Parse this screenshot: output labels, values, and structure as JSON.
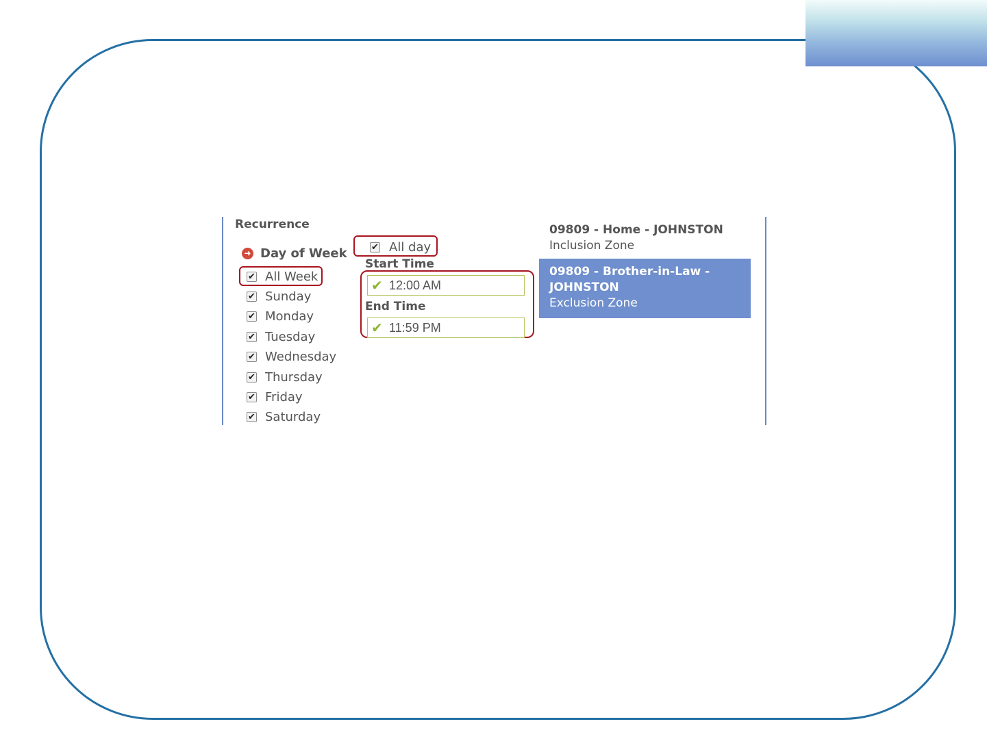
{
  "recurrence": {
    "title": "Recurrence",
    "day_of_week": {
      "title": "Day of Week",
      "icon": "arrow-right-circle-icon",
      "all_week": {
        "label": "All Week",
        "checked": true
      },
      "days": [
        {
          "label": "Sunday",
          "checked": true
        },
        {
          "label": "Monday",
          "checked": true
        },
        {
          "label": "Tuesday",
          "checked": true
        },
        {
          "label": "Wednesday",
          "checked": true
        },
        {
          "label": "Thursday",
          "checked": true
        },
        {
          "label": "Friday",
          "checked": true
        },
        {
          "label": "Saturday",
          "checked": true
        }
      ]
    },
    "all_day": {
      "label": "All day",
      "checked": true
    },
    "start_time": {
      "label": "Start Time",
      "value": "12:00 AM"
    },
    "end_time": {
      "label": "End Time",
      "value": "11:59 PM"
    }
  },
  "zones": [
    {
      "title": "09809 - Home - JOHNSTON",
      "type": "Inclusion Zone",
      "selected": false
    },
    {
      "title": "09809 - Brother-in-Law - JOHNSTON",
      "type": "Exclusion Zone",
      "selected": true
    }
  ],
  "colors": {
    "frame": "#2470a4",
    "highlight": "#a8141f",
    "selected_zone": "#6f8fce",
    "panel_border": "#6b88c4",
    "valid_tick": "#8db532"
  }
}
